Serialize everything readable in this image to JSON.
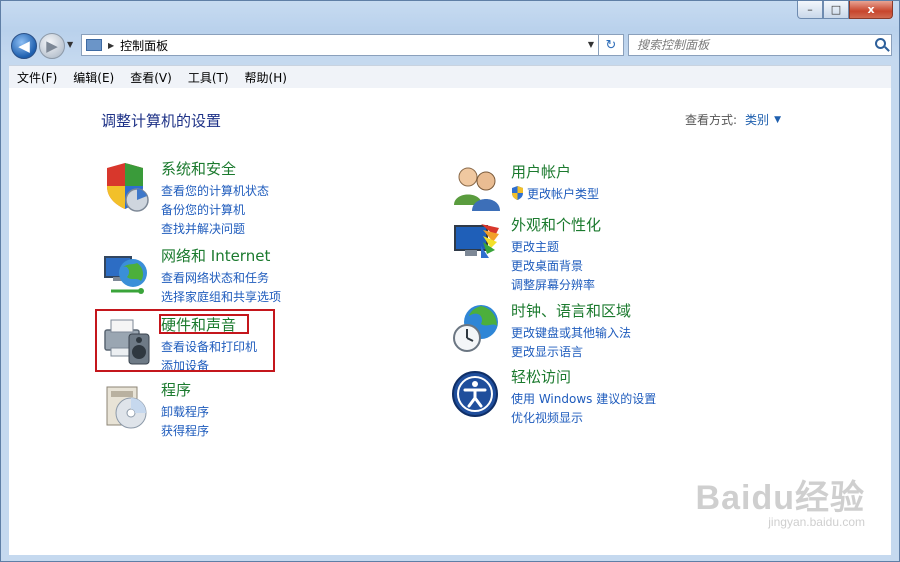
{
  "window": {
    "caption": {
      "minimize": "–",
      "maximize": "□",
      "close": "x"
    }
  },
  "nav": {
    "back_icon": "back-arrow-icon",
    "forward_icon": "forward-arrow-icon",
    "address_path": "控制面板",
    "search_placeholder": "搜索控制面板"
  },
  "menu": {
    "items": [
      "文件(F)",
      "编辑(E)",
      "查看(V)",
      "工具(T)",
      "帮助(H)"
    ]
  },
  "main": {
    "title": "调整计算机的设置",
    "view_by_label": "查看方式:",
    "view_by_value": "类别",
    "categories_left": [
      {
        "title": "系统和安全",
        "icon": "shield-icon",
        "links": [
          "查看您的计算机状态",
          "备份您的计算机",
          "查找并解决问题"
        ]
      },
      {
        "title": "网络和 Internet",
        "icon": "network-globe-icon",
        "links": [
          "查看网络状态和任务",
          "选择家庭组和共享选项"
        ]
      },
      {
        "title": "硬件和声音",
        "icon": "printer-speaker-icon",
        "links": [
          "查看设备和打印机",
          "添加设备"
        ]
      },
      {
        "title": "程序",
        "icon": "programs-disc-icon",
        "links": [
          "卸载程序",
          "获得程序"
        ]
      }
    ],
    "categories_right": [
      {
        "title": "用户帐户",
        "icon": "users-icon",
        "links": [
          "更改帐户类型"
        ]
      },
      {
        "title": "外观和个性化",
        "icon": "monitor-palette-icon",
        "links": [
          "更改主题",
          "更改桌面背景",
          "调整屏幕分辨率"
        ]
      },
      {
        "title": "时钟、语言和区域",
        "icon": "clock-globe-icon",
        "links": [
          "更改键盘或其他输入法",
          "更改显示语言"
        ]
      },
      {
        "title": "轻松访问",
        "icon": "ease-of-access-icon",
        "links": [
          "使用 Windows 建议的设置",
          "优化视频显示"
        ]
      }
    ]
  },
  "watermark": {
    "logo": "Baidu经验",
    "sub": "jingyan.baidu.com"
  },
  "colors": {
    "category_title": "#1b7a2e",
    "link": "#1f5cbd",
    "highlight": "#c4161c"
  }
}
